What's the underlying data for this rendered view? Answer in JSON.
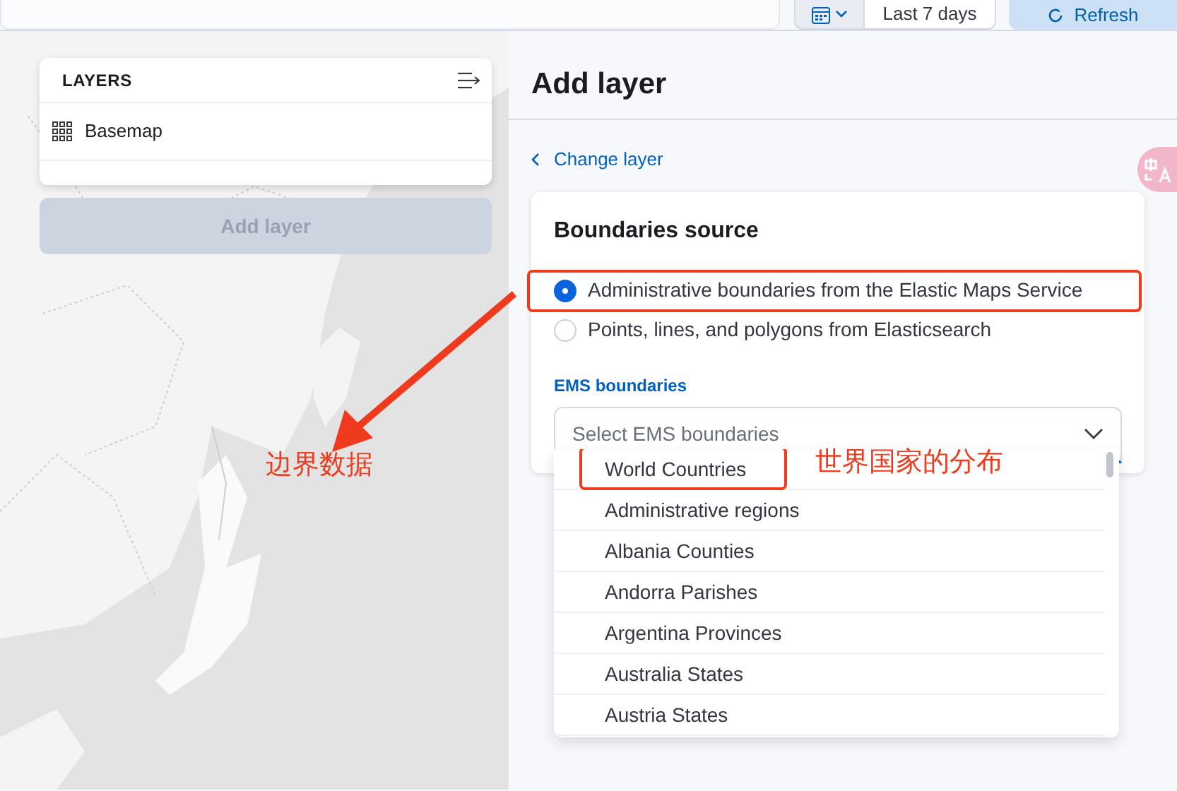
{
  "top_bar": {
    "date_range": "Last 7 days",
    "refresh_button": "Refresh"
  },
  "map": {
    "kind": "picture",
    "layers_panel": {
      "title": "LAYERS",
      "layers": [
        {
          "name": "Basemap"
        }
      ]
    },
    "add_layer_button": {
      "label": "Add layer",
      "disabled": true
    }
  },
  "panel": {
    "title": "Add layer",
    "back_link": "Change layer",
    "source_card": {
      "title": "Boundaries source",
      "options": [
        {
          "label": "Administrative boundaries from the Elastic Maps Service",
          "selected": true,
          "annotated": true
        },
        {
          "label": "Points, lines, and polygons from Elasticsearch",
          "selected": false,
          "annotated": false
        }
      ],
      "field_label": "EMS boundaries",
      "select": {
        "placeholder": "Select EMS boundaries",
        "expanded": true,
        "options": [
          {
            "label": "World Countries",
            "annotated": true
          },
          {
            "label": "Administrative regions",
            "annotated": false
          },
          {
            "label": "Albania Counties",
            "annotated": false
          },
          {
            "label": "Andorra Parishes",
            "annotated": false
          },
          {
            "label": "Argentina Provinces",
            "annotated": false
          },
          {
            "label": "Australia States",
            "annotated": false
          },
          {
            "label": "Austria States",
            "annotated": false
          }
        ]
      }
    }
  },
  "annotations": [
    {
      "kind": "arrow"
    },
    {
      "kind": "note",
      "text": "边界数据"
    },
    {
      "kind": "note",
      "text": "世界国家的分布"
    }
  ]
}
